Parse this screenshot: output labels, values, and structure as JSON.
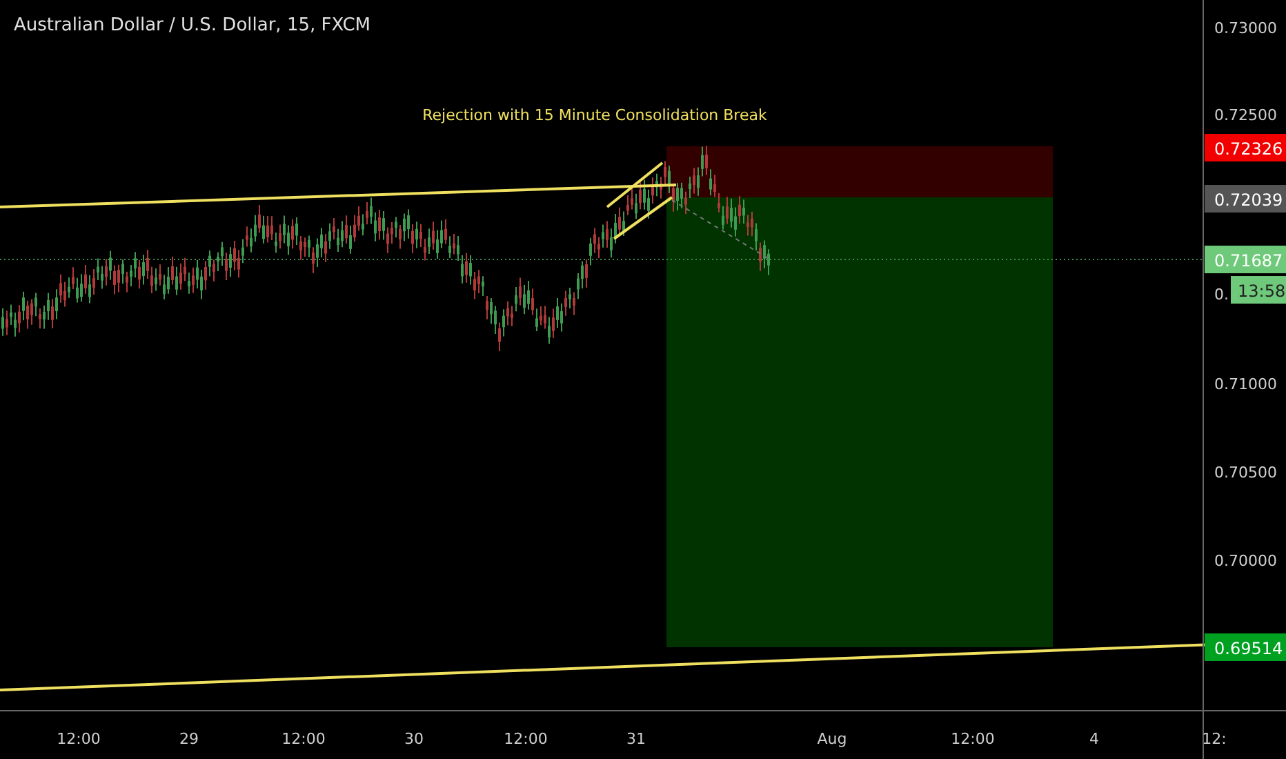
{
  "chart": {
    "title": "Australian Dollar / U.S. Dollar, 15, FXCM",
    "annotation": "Rejection with 15 Minute Consolidation Break"
  },
  "price_axis": {
    "labels": [
      "0.73000",
      "0.72500",
      "0.",
      "0.71000",
      "0.70500",
      "0.70000"
    ]
  },
  "price_tags": [
    {
      "text": "0.72326",
      "color": "#f20000"
    },
    {
      "text": "0.72039",
      "color": "#555555"
    },
    {
      "text": "0.71687",
      "color": "#6fc97a"
    },
    {
      "text": "0.69514",
      "color": "#00a020"
    }
  ],
  "countdown": "13:58",
  "time_axis": {
    "labels": [
      "12:00",
      "29",
      "12:00",
      "30",
      "12:00",
      "31",
      "Aug",
      "12:00",
      "4",
      "12:"
    ]
  }
}
